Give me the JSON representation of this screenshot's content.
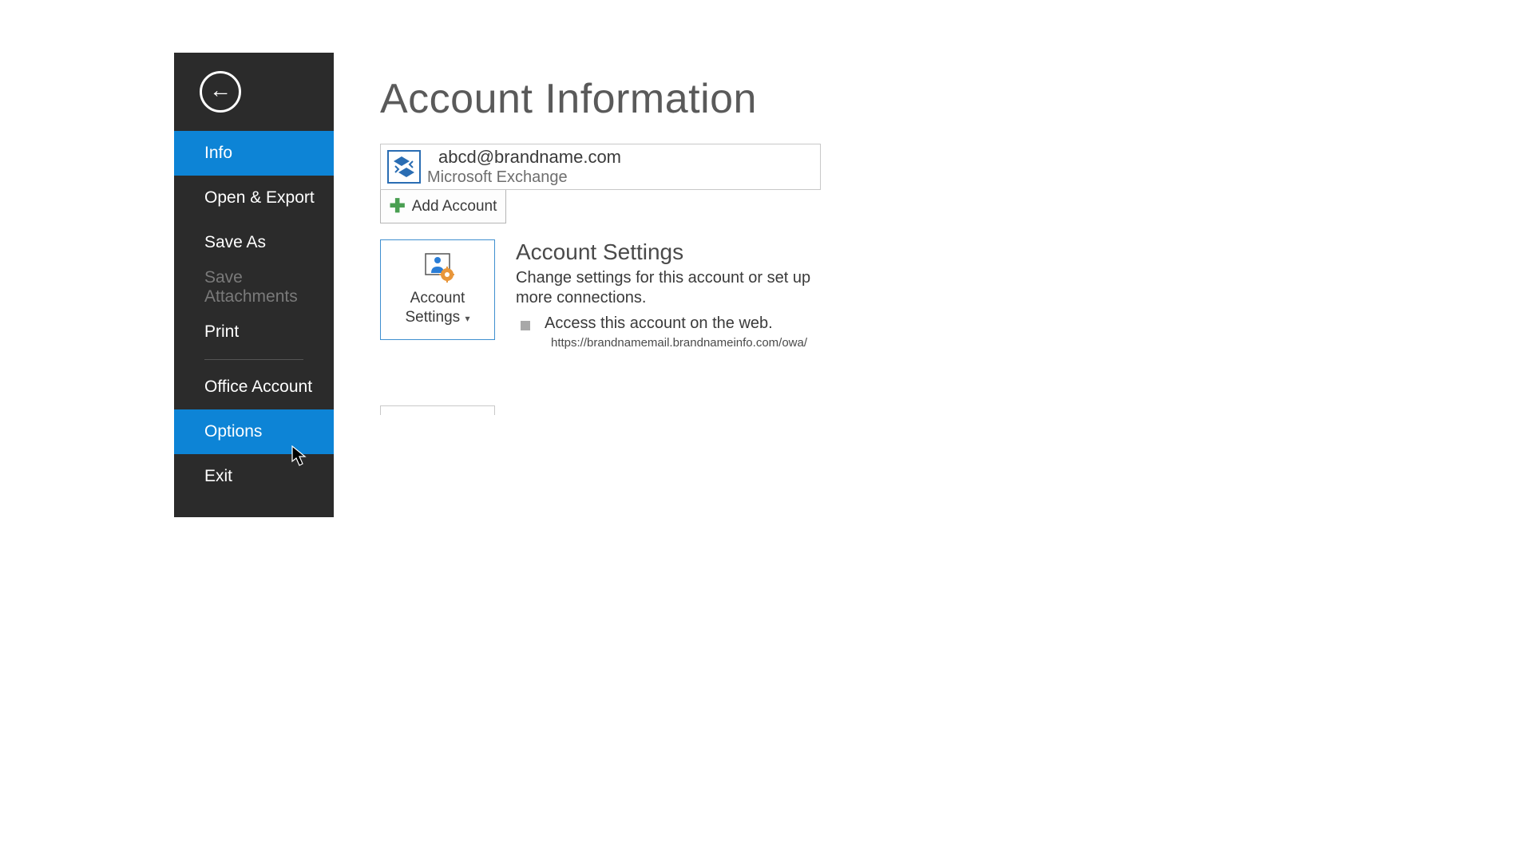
{
  "sidebar": {
    "items": [
      {
        "label": "Info",
        "state": "selected"
      },
      {
        "label": "Open & Export",
        "state": "normal"
      },
      {
        "label": "Save As",
        "state": "normal"
      },
      {
        "label": "Save Attachments",
        "state": "disabled"
      },
      {
        "label": "Print",
        "state": "normal"
      },
      {
        "label": "Office Account",
        "state": "normal"
      },
      {
        "label": "Options",
        "state": "hovered"
      },
      {
        "label": "Exit",
        "state": "normal"
      }
    ]
  },
  "content": {
    "title": "Account Information",
    "account": {
      "email": "abcd@brandname.com",
      "type": "Microsoft Exchange"
    },
    "add_account_label": "Add Account",
    "settings": {
      "tile_label_line1": "Account",
      "tile_label_line2": "Settings",
      "heading": "Account Settings",
      "description": "Change settings for this account or set up more connections.",
      "bullet_text": "Access this account on the web.",
      "url": "https://brandnamemail.brandnameinfo.com/owa/"
    }
  }
}
